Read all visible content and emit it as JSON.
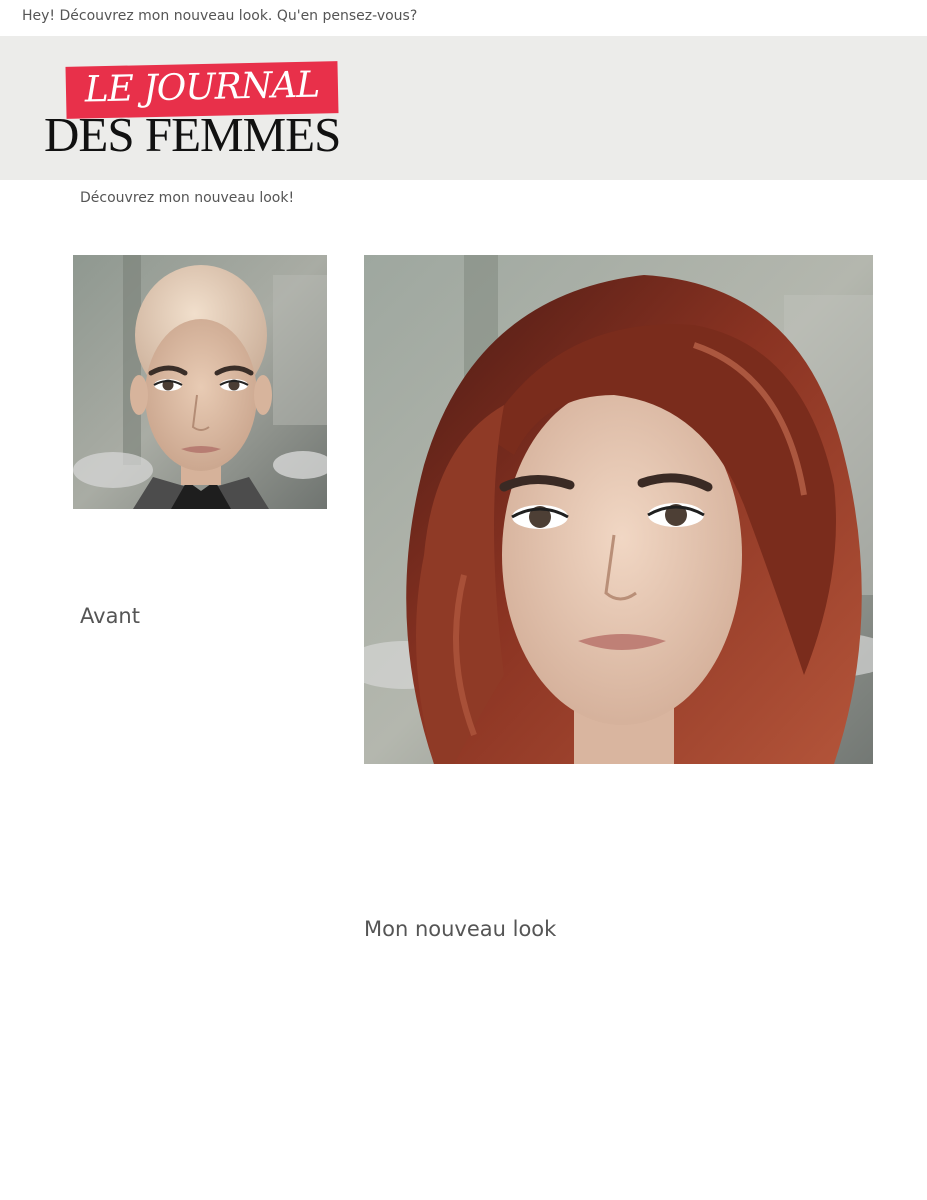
{
  "topbar": {
    "text": "Hey! Découvrez mon nouveau look. Qu'en pensez-vous?"
  },
  "header": {
    "logo_line1": "LE JOURNAL",
    "logo_line2": "DES FEMMES",
    "logo_accent_color": "#e8304a",
    "background_color": "#ececea"
  },
  "intro": {
    "text": "Découvrez mon nouveau look!"
  },
  "before": {
    "caption": "Avant"
  },
  "after": {
    "caption": "Mon nouveau look"
  }
}
